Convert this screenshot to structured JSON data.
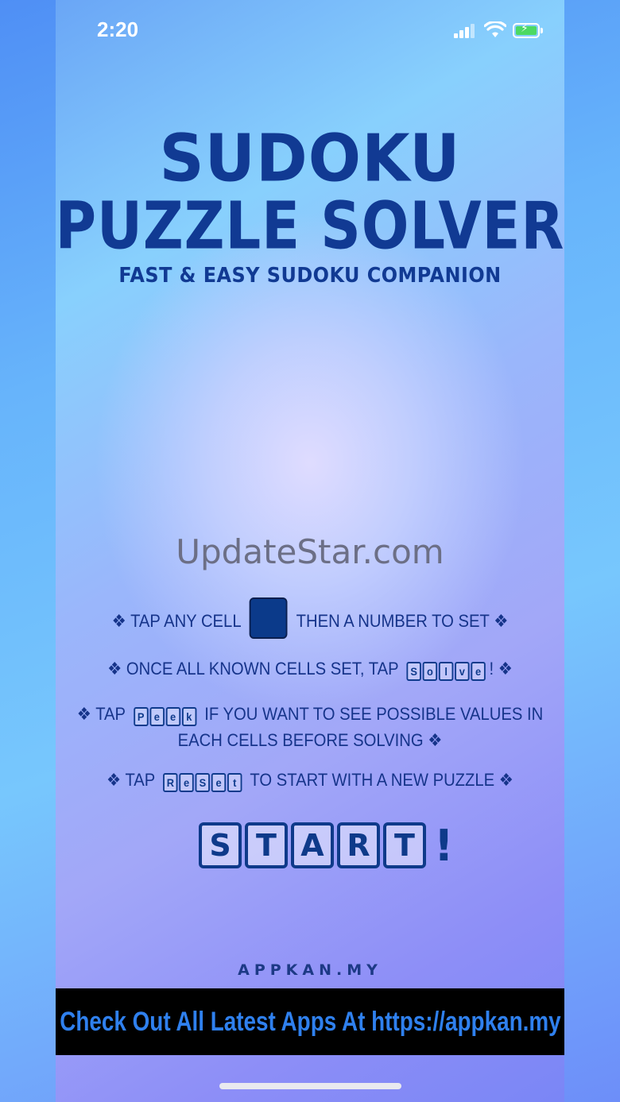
{
  "status_bar": {
    "time": "2:20",
    "signal_icon": "signal-bars-icon",
    "wifi_icon": "wifi-icon",
    "battery_icon": "battery-charging-icon",
    "battery_color": "#4cd964"
  },
  "header": {
    "title_line1": "SUDOKU",
    "title_line2": "PUZZLE SOLVER",
    "subtitle": "FAST & EASY SUDOKU COMPANION"
  },
  "watermark": "UpdateStar.com",
  "instructions": {
    "bullet": "❖",
    "line1_a": "TAP ANY CELL",
    "line1_b": "THEN A NUMBER TO SET",
    "line2_a": "ONCE ALL KNOWN CELLS SET, TAP",
    "line2_word": [
      "S",
      "o",
      "l",
      "v",
      "e"
    ],
    "line2_suffix": "!",
    "line3_a": "TAP",
    "line3_word": [
      "P",
      "e",
      "e",
      "k"
    ],
    "line3_b": "IF YOU WANT TO SEE POSSIBLE VALUES IN",
    "line3_c": "EACH CELLS BEFORE SOLVING",
    "line4_a": "TAP",
    "line4_word": [
      "R",
      "e",
      "S",
      "e",
      "t"
    ],
    "line4_b": "TO START WITH A NEW PUZZLE"
  },
  "start_button": {
    "letters": [
      "S",
      "T",
      "A",
      "R",
      "T"
    ],
    "suffix": "!"
  },
  "footer": {
    "brand": "APPKAN.MY",
    "banner_text": "Check Out All Latest Apps At https://appkan.my"
  },
  "colors": {
    "title": "#113a93",
    "banner_bg": "#000000",
    "banner_text": "#2f80ee"
  }
}
